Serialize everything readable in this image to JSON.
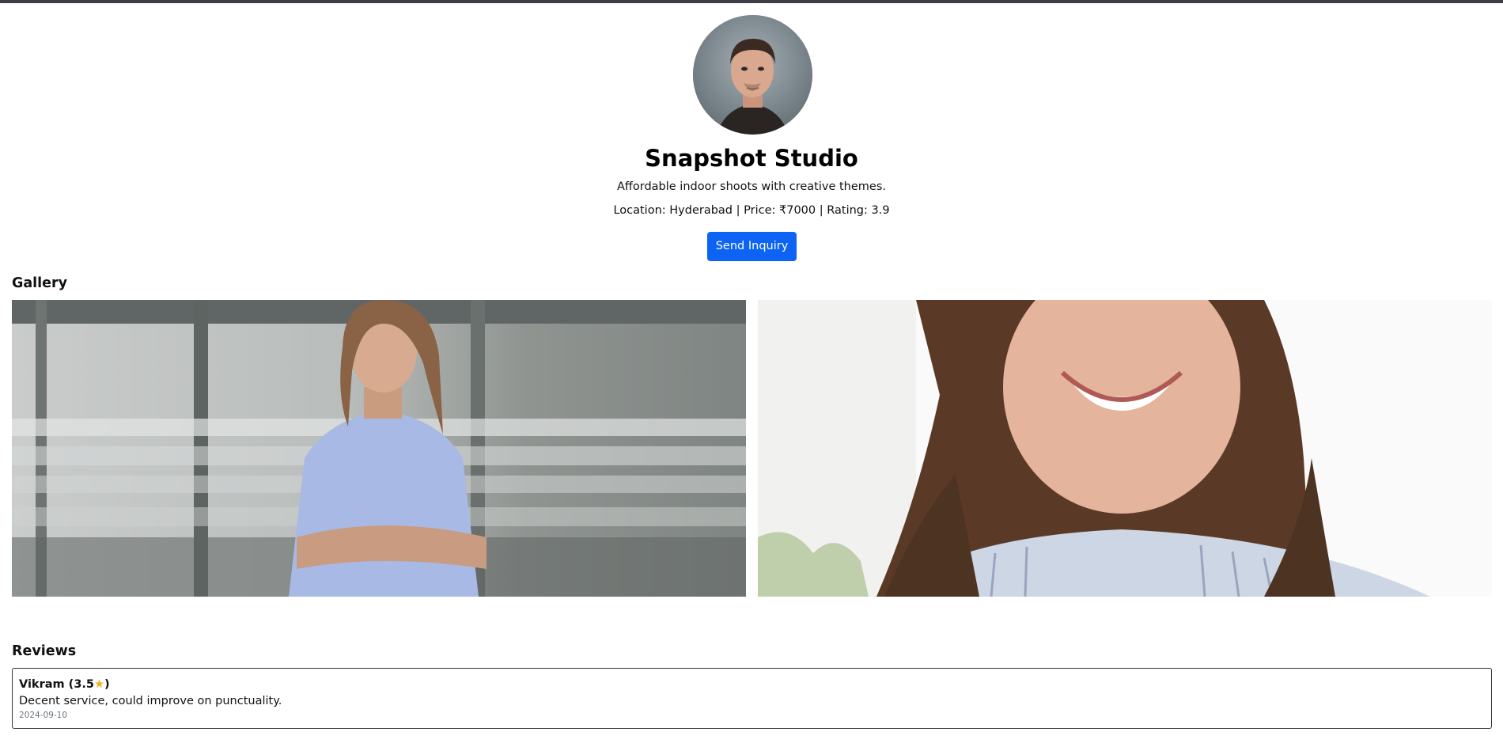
{
  "studio": {
    "name": "Snapshot Studio",
    "tagline": "Affordable indoor shoots with creative themes.",
    "location_label": "Location: ",
    "location": "Hyderabad",
    "price_label": " | Price: ",
    "price": "₹7000",
    "rating_label": " | Rating: ",
    "rating": "3.9",
    "inquiry_label": "Send Inquiry",
    "avatar_icon": "avatar-photo"
  },
  "gallery": {
    "title": "Gallery",
    "images": [
      {
        "alt": "gallery-photo-1"
      },
      {
        "alt": "gallery-photo-2"
      }
    ]
  },
  "reviews": {
    "title": "Reviews",
    "items": [
      {
        "author": "Vikram",
        "rating": "3.5",
        "star_icon": "star-icon",
        "text": "Decent service, could improve on punctuality.",
        "date": "2024-09-10"
      }
    ]
  },
  "colors": {
    "accent": "#0d63f3",
    "top_bar": "#3f3d44",
    "star": "#f2b01e"
  }
}
